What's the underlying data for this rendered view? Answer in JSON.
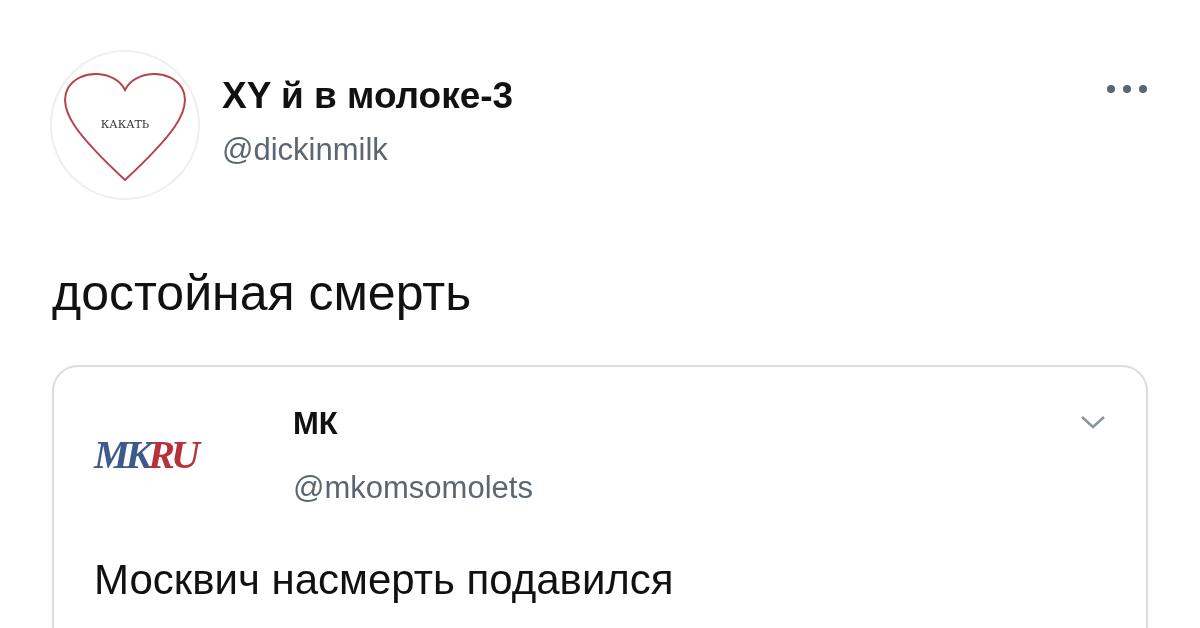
{
  "author": {
    "avatar_text": "КАКАТЬ",
    "name": "XY й в молоке-3",
    "handle": "@dickinmilk"
  },
  "tweet_text": "достойная смерть",
  "quoted": {
    "logo_parts": [
      {
        "text": "MK",
        "color": "#3c5a8c"
      },
      {
        "text": "RU",
        "color": "#b8303a"
      }
    ],
    "name": "МК",
    "handle": "@mkomsomolets",
    "text": "Москвич насмерть подавился"
  }
}
